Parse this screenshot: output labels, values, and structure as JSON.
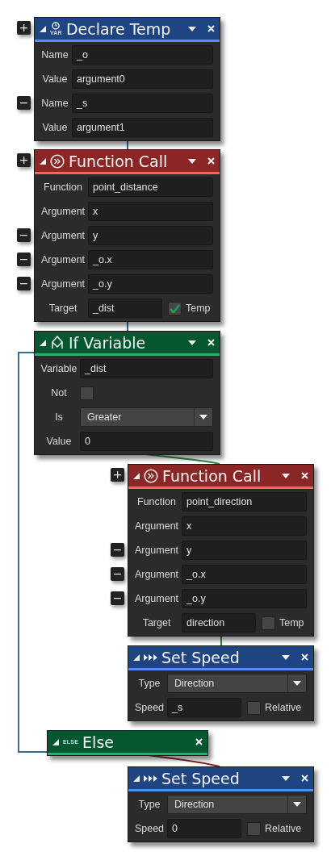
{
  "blocks": [
    {
      "kind": "declare",
      "title": "Declare Temp",
      "icon_label": "VAR",
      "color": "#1e4482",
      "add_button": "+",
      "rows": [
        {
          "kind": "text",
          "label": "Name",
          "value": "_o"
        },
        {
          "kind": "text",
          "label": "Value",
          "value": "argument0"
        },
        {
          "kind": "text",
          "label": "Name",
          "value": "_s",
          "remove_button": "−"
        },
        {
          "kind": "text",
          "label": "Value",
          "value": "argument1"
        }
      ]
    },
    {
      "kind": "function",
      "title": "Function Call",
      "color": "#8b2626",
      "add_button": "+",
      "rows": [
        {
          "kind": "text",
          "label": "Function",
          "value": "point_distance"
        },
        {
          "kind": "text",
          "label": "Argument",
          "value": "x"
        },
        {
          "kind": "text",
          "label": "Argument",
          "value": "y",
          "remove_button": "−"
        },
        {
          "kind": "text",
          "label": "Argument",
          "value": "_o.x",
          "remove_button": "−"
        },
        {
          "kind": "text",
          "label": "Argument",
          "value": "_o.y",
          "remove_button": "−"
        },
        {
          "kind": "target",
          "label": "Target",
          "value": "_dist",
          "check_label": "Temp",
          "checked": true
        }
      ]
    },
    {
      "kind": "if",
      "title": "If Variable",
      "color": "#04572f",
      "rows": [
        {
          "kind": "text",
          "label": "Variable",
          "value": "_dist"
        },
        {
          "kind": "check",
          "label": "Not",
          "checked": false
        },
        {
          "kind": "select",
          "label": "Is",
          "value": "Greater"
        },
        {
          "kind": "text",
          "label": "Value",
          "value": "0"
        }
      ]
    },
    {
      "kind": "function",
      "title": "Function Call",
      "color": "#8b2626",
      "add_button": "+",
      "rows": [
        {
          "kind": "text",
          "label": "Function",
          "value": "point_direction"
        },
        {
          "kind": "text",
          "label": "Argument",
          "value": "x"
        },
        {
          "kind": "text",
          "label": "Argument",
          "value": "y",
          "remove_button": "−"
        },
        {
          "kind": "text",
          "label": "Argument",
          "value": "_o.x",
          "remove_button": "−"
        },
        {
          "kind": "text",
          "label": "Argument",
          "value": "_o.y",
          "remove_button": "−"
        },
        {
          "kind": "target",
          "label": "Target",
          "value": "direction",
          "check_label": "Temp",
          "checked": false
        }
      ]
    },
    {
      "kind": "speed",
      "title": "Set Speed",
      "color": "#1e4482",
      "rows": [
        {
          "kind": "select",
          "label": "Type",
          "value": "Direction"
        },
        {
          "kind": "target",
          "label": "Speed",
          "value": "_s",
          "check_label": "Relative",
          "checked": false
        }
      ]
    },
    {
      "kind": "else",
      "title": "Else",
      "icon_label": "ELSE",
      "color": "#04572f"
    },
    {
      "kind": "speed",
      "title": "Set Speed",
      "color": "#1e4482",
      "rows": [
        {
          "kind": "select",
          "label": "Type",
          "value": "Direction"
        },
        {
          "kind": "target",
          "label": "Speed",
          "value": "0",
          "check_label": "Relative",
          "checked": false
        }
      ]
    }
  ]
}
